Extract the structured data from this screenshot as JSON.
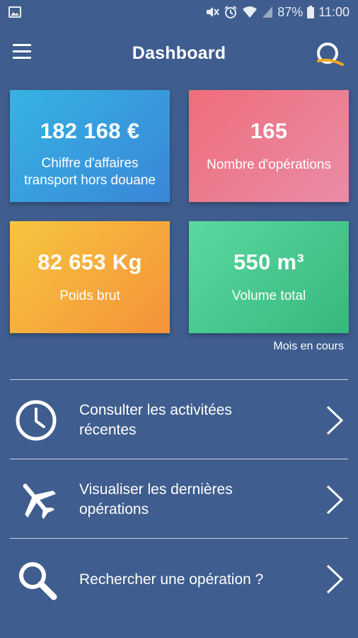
{
  "status_bar": {
    "battery": "87%",
    "time": "11:00"
  },
  "app_bar": {
    "title": "Dashboard"
  },
  "cards": [
    {
      "value": "182 168 €",
      "label_line1": "Chiffre d'affaires",
      "label_line2": "transport hors douane",
      "gradient": [
        "#35b3e2",
        "#3a86d8"
      ]
    },
    {
      "value": "165",
      "label_line1": "Nombre d'opérations",
      "gradient": [
        "#ef6d7b",
        "#e98ca6"
      ]
    },
    {
      "value": "82 653 Kg",
      "label_line1": "Poids brut",
      "gradient": [
        "#f6c63e",
        "#f5913a"
      ]
    },
    {
      "value": "550 m³",
      "label_line1": "Volume total",
      "gradient": [
        "#5ad8a0",
        "#36b87c"
      ]
    }
  ],
  "period_label": "Mois en cours",
  "actions": [
    {
      "icon": "clock-icon",
      "line1": "Consulter les activitées",
      "line2": "récentes"
    },
    {
      "icon": "airplane-icon",
      "line1": "Visualiser les dernières",
      "line2": "opérations"
    },
    {
      "icon": "search-icon",
      "line1": "Rechercher une opération ?"
    }
  ],
  "colors": {
    "background": "#3f5d8e",
    "text": "#ffffff"
  }
}
